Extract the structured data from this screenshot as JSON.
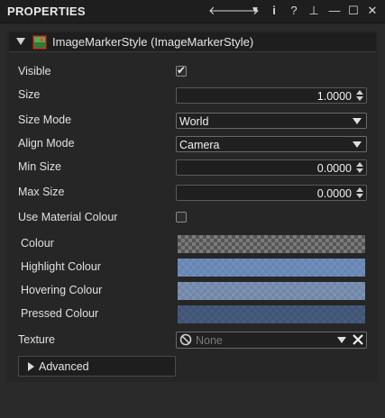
{
  "header": {
    "title": "PROPERTIES",
    "icons": [
      "back-arrow-icon",
      "forward-arrow-icon",
      "dropdown-icon",
      "help-icon",
      "info-icon",
      "pin-icon",
      "minimize-icon",
      "maximize-icon",
      "close-icon"
    ],
    "glyphs": {
      "back": "🡐",
      "forward": "🡒",
      "menu": "▼",
      "help": "i",
      "info": "?",
      "pin": "⊥",
      "minimize": "—",
      "maximize": "☐",
      "close": "✕"
    }
  },
  "section": {
    "label": "ImageMarkerStyle (ImageMarkerStyle)",
    "expanded": true
  },
  "properties": {
    "visible": {
      "label": "Visible",
      "checked": true,
      "tick": "✔"
    },
    "size": {
      "label": "Size",
      "value": "1.0000"
    },
    "size_mode": {
      "label": "Size Mode",
      "value": "World"
    },
    "align_mode": {
      "label": "Align Mode",
      "value": "Camera"
    },
    "min_size": {
      "label": "Min Size",
      "value": "0.0000"
    },
    "max_size": {
      "label": "Max Size",
      "value": "0.0000"
    },
    "use_material_colour": {
      "label": "Use Material Colour",
      "checked": false
    },
    "colour": {
      "label": "Colour",
      "tint": "rgba(0,0,0,0)"
    },
    "highlight_colour": {
      "label": "Highlight Colour",
      "tint": "rgba(110,150,210,0.75)"
    },
    "hovering_colour": {
      "label": "Hovering Colour",
      "tint": "rgba(125,155,200,0.72)"
    },
    "pressed_colour": {
      "label": "Pressed Colour",
      "tint": "rgba(60,85,125,0.82)"
    },
    "texture": {
      "label": "Texture",
      "value": "None"
    }
  },
  "advanced": {
    "label": "Advanced"
  }
}
